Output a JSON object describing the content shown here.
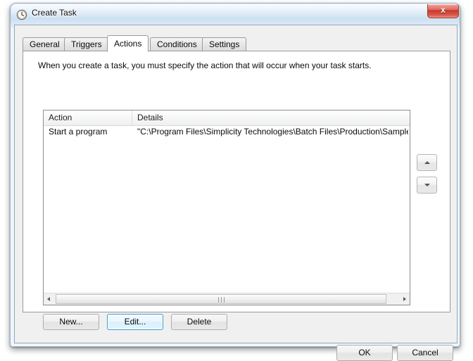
{
  "window": {
    "title": "Create Task",
    "icon": "clock-icon",
    "close_label": "x",
    "accent_close": "#c53a2c",
    "frame_color": "#cfe2f4"
  },
  "tabs": [
    {
      "label": "General",
      "selected": false
    },
    {
      "label": "Triggers",
      "selected": false
    },
    {
      "label": "Actions",
      "selected": true
    },
    {
      "label": "Conditions",
      "selected": false
    },
    {
      "label": "Settings",
      "selected": false
    }
  ],
  "page": {
    "instruction": "When you create a task, you must specify the action that will occur when your task starts."
  },
  "list": {
    "columns": [
      "Action",
      "Details"
    ],
    "rows": [
      {
        "action": "Start a program",
        "details": "\"C:\\Program Files\\Simplicity Technologies\\Batch Files\\Production\\Sample"
      }
    ],
    "scrollbar": {
      "left_arrow": "scroll-left-icon",
      "right_arrow": "scroll-right-icon",
      "grip": "scroll-thumb-grip"
    }
  },
  "reorder": {
    "move_up": "arrow-up-icon",
    "move_down": "arrow-down-icon"
  },
  "action_buttons": [
    {
      "label": "New...",
      "focused": false
    },
    {
      "label": "Edit...",
      "focused": true
    },
    {
      "label": "Delete",
      "focused": false
    }
  ],
  "footer": {
    "ok_label": "OK",
    "cancel_label": "Cancel"
  }
}
